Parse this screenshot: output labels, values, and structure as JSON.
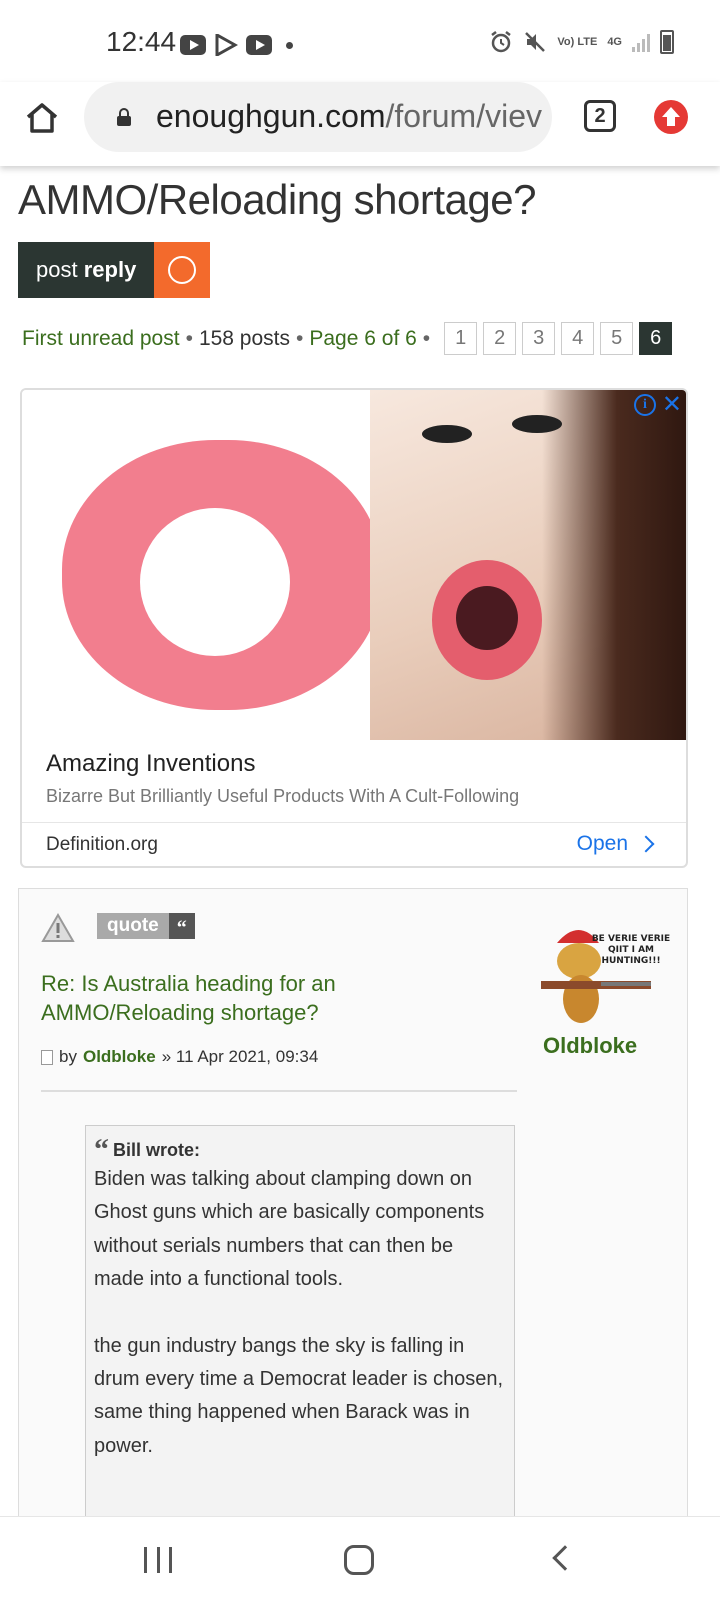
{
  "status_bar": {
    "time": "12:44",
    "left_icons": [
      "youtube-icon",
      "play-store-icon",
      "youtube-icon",
      "dot-icon"
    ],
    "right_icons": [
      "alarm-icon",
      "mute-icon",
      "volte-icon",
      "4g-icon",
      "signal-icon",
      "battery-icon"
    ],
    "volte_label": "Vo) LTE",
    "network_label": "4G"
  },
  "browser": {
    "url_domain": "enoughgun.com",
    "url_path": "/forum/viev",
    "tab_count": "2"
  },
  "topic": {
    "title": "AMMO/Reloading shortage?",
    "title_partial": "Is Australia heading for an",
    "post_reply_prefix": "post",
    "post_reply_bold": "reply"
  },
  "pagination": {
    "first_unread": "First unread post",
    "posts_count": "158 posts",
    "page_label": "Page 6 of 6",
    "separator": "•",
    "pages": [
      "1",
      "2",
      "3",
      "4",
      "5",
      "6"
    ],
    "current_page": "6"
  },
  "ad": {
    "title": "Amazing Inventions",
    "description": "Bizarre But Brilliantly Useful Products With A Cult-Following",
    "domain": "Definition.org",
    "cta": "Open",
    "info_label": "i",
    "close_label": "✕"
  },
  "post": {
    "quote_label": "quote",
    "quote_icon": "“",
    "title": "Re: Is Australia heading for an AMMO/Reloading shortage?",
    "by_label": "by",
    "author": "Oldbloke",
    "date": "» 11 Apr 2021, 09:34",
    "avatar_name": "Oldbloke",
    "avatar_caption": "BE VERIE VERIE QIIT I AM HUNTING!!!",
    "quote_block": {
      "cite_mark": "“",
      "cite": "Bill wrote:",
      "paragraphs": [
        "Biden was talking about clamping down on Ghost guns which are basically components without serials numbers that can then be made into a functional tools.",
        "the gun industry bangs the sky is falling in drum every time a Democrat leader is chosen, same thing happened when Barack was in power."
      ]
    }
  },
  "colors": {
    "accent_green": "#3b6e1e",
    "dark_button": "#2b3632",
    "orange": "#f36a2c",
    "link_blue": "#1a73e8"
  }
}
